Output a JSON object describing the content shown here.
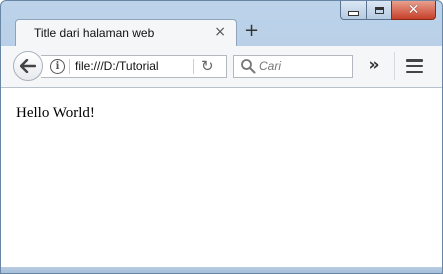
{
  "tab": {
    "title": "Title dari halaman web",
    "close_glyph": "×"
  },
  "new_tab_glyph": "+",
  "window_controls": {
    "close_glyph": "✕"
  },
  "urlbar": {
    "url": "file:///D:/Tutorial",
    "info_glyph": "i",
    "reload_glyph": "↻"
  },
  "searchbar": {
    "placeholder": "Cari"
  },
  "toolbar": {
    "overflow_glyph": "»"
  },
  "page": {
    "body_text": "Hello World!"
  },
  "icons": {
    "back": "back-arrow-icon",
    "info": "info-icon",
    "reload": "reload-icon",
    "search": "search-icon",
    "overflow": "chevron-double-right-icon",
    "menu": "hamburger-menu-icon"
  },
  "colors": {
    "window_frame": "#bcd3ea",
    "close_button": "#c7402a",
    "toolbar": "#f5f6f7"
  }
}
